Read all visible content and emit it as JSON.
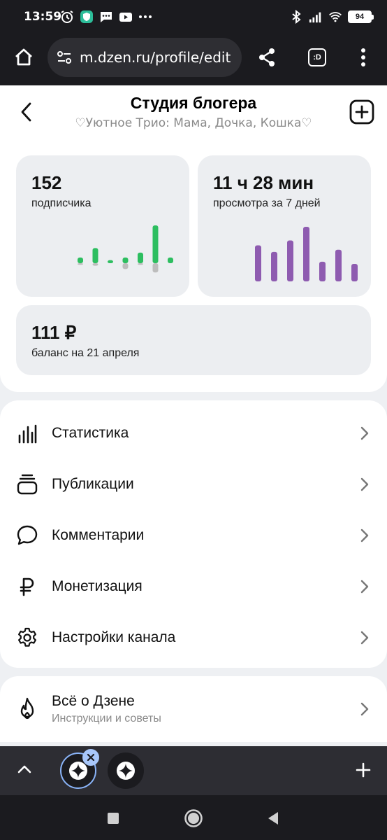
{
  "status_bar": {
    "time": "13:59",
    "battery": "94",
    "left_icons": [
      "alarm-icon",
      "shield-app-icon",
      "message-icon",
      "youtube-icon",
      "more-dots-icon"
    ],
    "right_icons": [
      "bluetooth-icon",
      "signal-icon",
      "wifi-icon",
      "battery-icon"
    ]
  },
  "browser": {
    "url": "m.dzen.ru/profile/edit",
    "tab_switcher_label": ":D"
  },
  "header": {
    "title": "Студия блогера",
    "subtitle": "♡Уютное Трио: Мама, Дочка, Кошка♡"
  },
  "stats": {
    "subscribers": {
      "value": "152",
      "label": "подписчика",
      "color": "#2dbe60",
      "bars_up": [
        0.15,
        0.4,
        0.08,
        0.15,
        0.28,
        1.0,
        0.15
      ],
      "bars_down": [
        0.04,
        0.06,
        0.0,
        0.14,
        0.04,
        0.22,
        0.0
      ]
    },
    "views": {
      "value": "11 ч 28 мин",
      "label": "просмотра за 7 дней",
      "color": "#8e5bb0",
      "bars": [
        0.66,
        0.54,
        0.75,
        1.0,
        0.36,
        0.58,
        0.32
      ]
    },
    "balance": {
      "value": "111 ₽",
      "label": "баланс на 21 апреля"
    }
  },
  "menu": {
    "items": [
      {
        "label": "Статистика",
        "icon": "bar-chart-icon"
      },
      {
        "label": "Публикации",
        "icon": "stack-icon"
      },
      {
        "label": "Комментарии",
        "icon": "comment-icon"
      },
      {
        "label": "Монетизация",
        "icon": "ruble-icon"
      },
      {
        "label": "Настройки канала",
        "icon": "gear-icon"
      }
    ]
  },
  "about": {
    "title": "Всё о Дзене",
    "subtitle": "Инструкции и советы",
    "icon": "flame-icon"
  }
}
